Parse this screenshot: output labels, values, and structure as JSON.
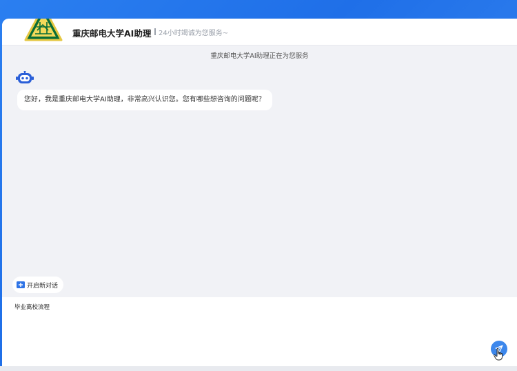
{
  "header": {
    "logo": "university-emblem",
    "title": "重庆邮电大学AI助理",
    "separator": "|",
    "subtitle": "24小时竭诚为您服务~"
  },
  "chat": {
    "notice": "重庆邮电大学AI助理正在为您服务",
    "messages": [
      {
        "role": "assistant",
        "avatar_icon": "robot-icon",
        "text": "您好，我是重庆邮电大学AI助理，非常高兴认识您。您有哪些想咨询的问题呢？"
      }
    ]
  },
  "new_chat": {
    "icon": "new-chat-icon",
    "label": "开启新对话"
  },
  "composer": {
    "value": "毕业离校流程",
    "send_icon": "send-icon"
  },
  "colors": {
    "accent": "#3c87ec",
    "background": "#f1f2f6",
    "header_bg": "#ffffff",
    "outer_bg": "#2b7ff0"
  }
}
